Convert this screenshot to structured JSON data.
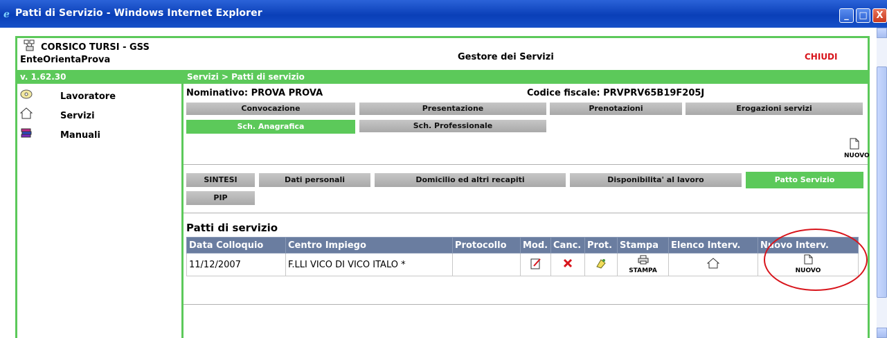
{
  "window": {
    "title": "Patti di Servizio - Windows Internet Explorer",
    "minimize": "_",
    "maximize": "□",
    "close": "X"
  },
  "header": {
    "org_name": "CORSICO TURSI - GSS",
    "org_sub": "EnteOrientaProva",
    "app_title": "Gestore dei Servizi",
    "close_label": "CHIUDI",
    "version": "v. 1.62.30",
    "breadcrumb": "Servizi > Patti di servizio"
  },
  "sidebar": {
    "items": [
      {
        "label": "Lavoratore",
        "icon": "cd-icon"
      },
      {
        "label": "Servizi",
        "icon": "house-icon"
      },
      {
        "label": "Manuali",
        "icon": "books-icon"
      }
    ]
  },
  "person": {
    "nominativo": "Nominativo: PROVA  PROVA",
    "codice_fiscale": "Codice fiscale: PRVPRV65B19F205J"
  },
  "tabs_row1": [
    "Convocazione",
    "Presentazione",
    "Prenotazioni",
    "Erogazioni servizi"
  ],
  "tabs_row2": [
    "Sch. Anagrafica",
    "Sch. Professionale"
  ],
  "nuovo_label": "NUOVO",
  "subtabs_row1": [
    "SINTESI",
    "Dati personali",
    "Domicilio ed altri recapiti",
    "Disponibilita' al lavoro",
    "Patto Servizio"
  ],
  "subtabs_row2": [
    "PIP"
  ],
  "section_title": "Patti di servizio",
  "table": {
    "headers": [
      "Data Colloquio",
      "Centro Impiego",
      "Protocollo",
      "Mod.",
      "Canc.",
      "Prot.",
      "Stampa",
      "Elenco Interv.",
      "Nuovo Interv."
    ],
    "rows": [
      {
        "data": "11/12/2007",
        "centro": "F.LLI VICO DI VICO ITALO *",
        "protocollo": "",
        "stampa_label": "STAMPA",
        "nuovo_label": "NUOVO"
      }
    ]
  },
  "colors": {
    "accent": "#5cc95a",
    "header_blue": "#6a7da0",
    "close_red": "#d8141b"
  }
}
